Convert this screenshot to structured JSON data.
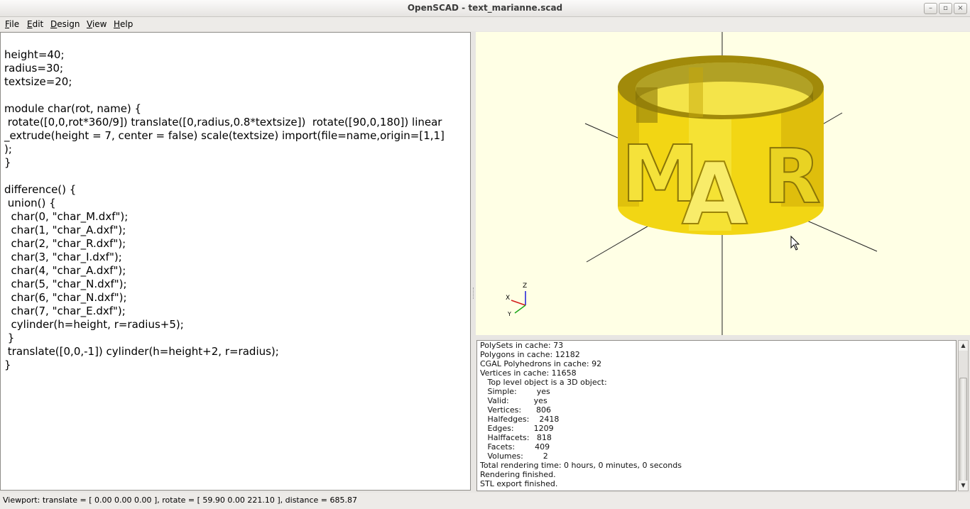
{
  "window": {
    "title": "OpenSCAD - text_marianne.scad",
    "minimize": "–",
    "maximize": "▫",
    "close": "×"
  },
  "menu": [
    {
      "label": "File",
      "accel": "F",
      "rest": "ile"
    },
    {
      "label": "Edit",
      "accel": "E",
      "rest": "dit"
    },
    {
      "label": "Design",
      "accel": "D",
      "rest": "esign"
    },
    {
      "label": "View",
      "accel": "V",
      "rest": "iew"
    },
    {
      "label": "Help",
      "accel": "H",
      "rest": "elp"
    }
  ],
  "editor": {
    "code": "height=40;\nradius=30;\ntextsize=20;\n\nmodule char(rot, name) {\n rotate([0,0,rot*360/9]) translate([0,radius,0.8*textsize])  rotate([90,0,180]) linear\n_extrude(height = 7, center = false) scale(textsize) import(file=name,origin=[1,1]\n);\n}\n\ndifference() {\n union() {\n  char(0, \"char_M.dxf\");\n  char(1, \"char_A.dxf\");\n  char(2, \"char_R.dxf\");\n  char(3, \"char_I.dxf\");\n  char(4, \"char_A.dxf\");\n  char(5, \"char_N.dxf\");\n  char(6, \"char_N.dxf\");\n  char(7, \"char_E.dxf\");\n  cylinder(h=height, r=radius+5);\n }\n translate([0,0,-1]) cylinder(h=height+2, r=radius);\n}"
  },
  "viewport": {
    "background": "#ffffe5",
    "model_color": "#f5e23a",
    "letters": [
      "M",
      "A",
      "R"
    ],
    "axis_labels": {
      "z": "Z",
      "x": "X",
      "y": "Y"
    }
  },
  "console": {
    "lines": [
      "PolySets in cache: 73",
      "Polygons in cache: 12182",
      "CGAL Polyhedrons in cache: 92",
      "Vertices in cache: 11658",
      "   Top level object is a 3D object:",
      "   Simple:        yes",
      "   Valid:          yes",
      "   Vertices:      806",
      "   Halfedges:    2418",
      "   Edges:        1209",
      "   Halffacets:   818",
      "   Facets:        409",
      "   Volumes:        2",
      "Total rendering time: 0 hours, 0 minutes, 0 seconds",
      "Rendering finished.",
      "STL export finished."
    ]
  },
  "status": {
    "text": "Viewport: translate = [ 0.00 0.00 0.00 ], rotate = [ 59.90 0.00 221.10 ], distance = 685.87"
  }
}
